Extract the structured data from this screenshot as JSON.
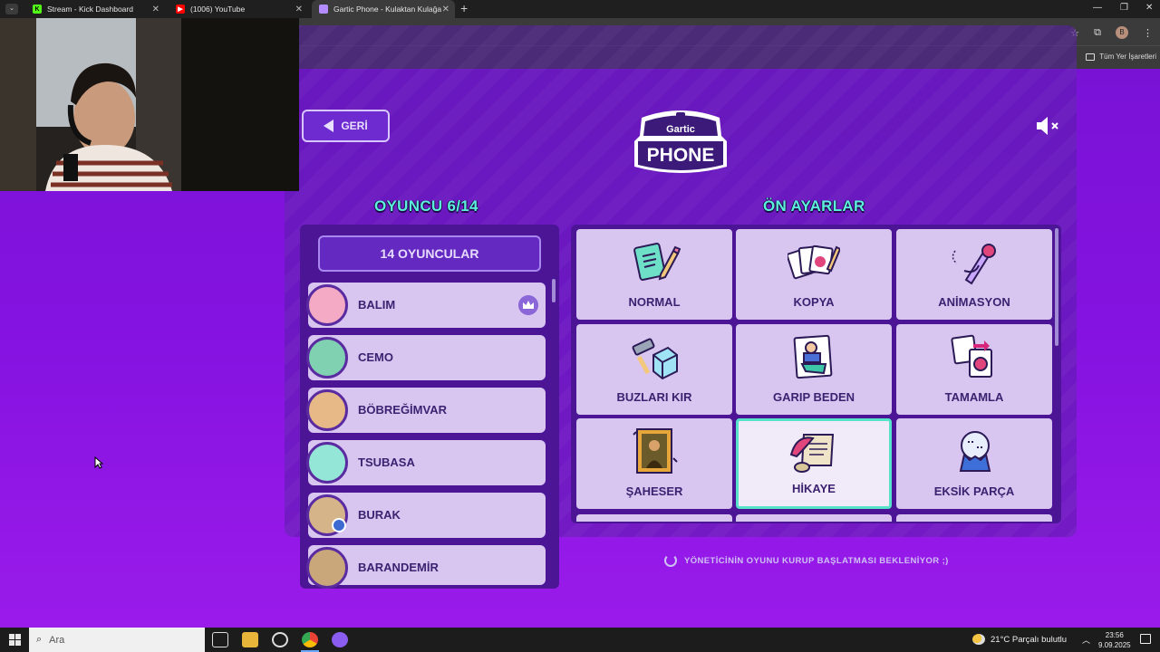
{
  "browser": {
    "tabs": [
      {
        "title": "Stream - Kick Dashboard",
        "favicon": "kick-icon",
        "color": "#53fc18"
      },
      {
        "title": "(1006) YouTube",
        "favicon": "youtube-icon",
        "color": "#ff0000"
      },
      {
        "title": "Gartic Phone - Kulaktan Kulağa",
        "favicon": "gartic-icon",
        "color": "#b38cff",
        "active": true
      }
    ],
    "new_tab": "+",
    "bookmarks_all": "Tüm Yer İşaretleri",
    "profile_initial": "B"
  },
  "game": {
    "back_label": "GERİ",
    "logo_top": "Gartic",
    "logo_bottom": "PHONE",
    "players_title": "OYUNCU 6/14",
    "player_count_button": "14 OYUNCULAR",
    "players": [
      {
        "name": "BALIM",
        "host": true,
        "avatar_color": "#f4a9c4"
      },
      {
        "name": "CEMO",
        "avatar_color": "#7fd1b2"
      },
      {
        "name": "BÖBREĞİMVAR",
        "avatar_color": "#e6b987"
      },
      {
        "name": "TSUBASA",
        "avatar_color": "#94e6d6"
      },
      {
        "name": "BURAK",
        "avatar_color": "#d6b48a",
        "badge": true
      },
      {
        "name": "BARANDEMİR",
        "avatar_color": "#c9a77a"
      }
    ],
    "presets_title": "ÖN AYARLAR",
    "presets": [
      {
        "label": "NORMAL",
        "icon": "notepad-pencil-icon"
      },
      {
        "label": "KOPYA",
        "icon": "cards-pencil-icon"
      },
      {
        "label": "ANİMASYON",
        "icon": "animation-pencil-icon"
      },
      {
        "label": "BUZLARI KIR",
        "icon": "hammer-ice-icon"
      },
      {
        "label": "GARIP BEDEN",
        "icon": "weird-body-icon"
      },
      {
        "label": "TAMAMLA",
        "icon": "puzzle-complete-icon"
      },
      {
        "label": "ŞAHESER",
        "icon": "masterpiece-frame-icon"
      },
      {
        "label": "HİKAYE",
        "icon": "story-scroll-icon",
        "selected": true
      },
      {
        "label": "EKSİK PARÇA",
        "icon": "missing-piece-icon"
      }
    ],
    "status": "YÖNETİCİNİN OYUNU KURUP BAŞLATMASI BEKLENİYOR ;)"
  },
  "taskbar": {
    "search_placeholder": "Ara",
    "weather": "21°C  Parçalı bulutlu",
    "time": "23:56",
    "date": "9.09.2025"
  },
  "colors": {
    "accent_teal": "#5cf1de",
    "page_purple": "#8412e0",
    "card_lilac": "#d8c6f1",
    "text_dark": "#3c2270"
  }
}
